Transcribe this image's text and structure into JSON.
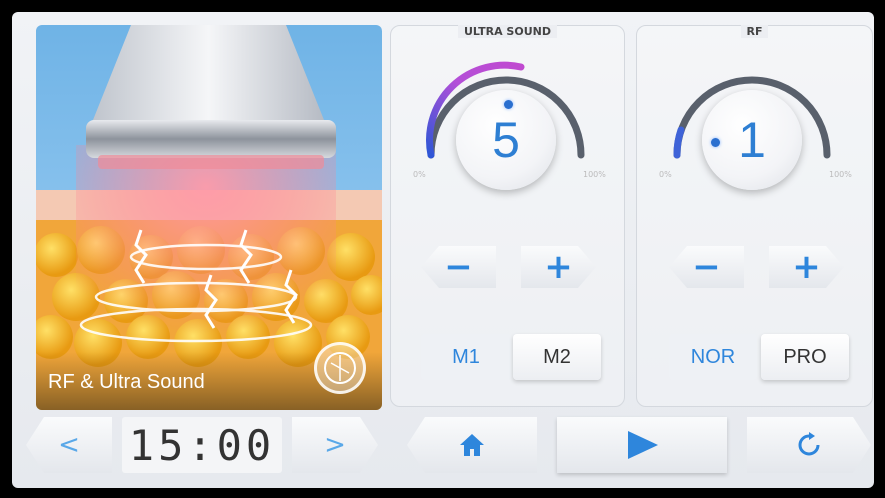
{
  "ultrasound": {
    "title": "ULTRA SOUND",
    "value": "5",
    "level_fraction": 0.5,
    "min_label": "0%",
    "max_label": "100%",
    "minus_icon": "minus-icon",
    "plus_icon": "plus-icon",
    "modes": [
      "M1",
      "M2"
    ],
    "active_mode": "M1"
  },
  "rf": {
    "title": "RF",
    "value": "1",
    "level_fraction": 0.1,
    "min_label": "0%",
    "max_label": "100%",
    "modes": [
      "NOR",
      "PRO"
    ],
    "active_mode": "NOR"
  },
  "hero": {
    "caption": "RF & Ultra Sound"
  },
  "timer": {
    "value": "15:00"
  },
  "bottom_icons": {
    "prev": "chevron-left-icon",
    "next": "chevron-right-icon",
    "home": "home-icon",
    "play": "play-icon",
    "reset": "refresh-icon"
  },
  "colors": {
    "accent": "#2e86dc",
    "gauge_track": "#5a5f6a",
    "gauge_start": "#3f63d8",
    "gauge_mid": "#b04fd6"
  }
}
